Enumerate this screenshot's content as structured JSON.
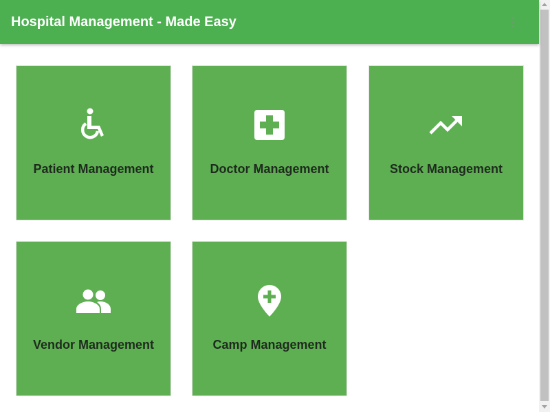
{
  "app": {
    "title": "Hospital Management - Made Easy",
    "brand_color": "#4caf50",
    "menu_icon": "more-vert-icon"
  },
  "tiles": [
    {
      "label": "Patient Management",
      "icon": "wheelchair-icon"
    },
    {
      "label": "Doctor Management",
      "icon": "medical-cross-icon"
    },
    {
      "label": "Stock Management",
      "icon": "trending-up-icon"
    },
    {
      "label": "Vendor Management",
      "icon": "people-icon"
    },
    {
      "label": "Camp Management",
      "icon": "add-location-icon"
    }
  ],
  "colors": {
    "tile_background": "#5daf51",
    "tile_label": "#1f2a1f",
    "icon": "#ffffff"
  }
}
